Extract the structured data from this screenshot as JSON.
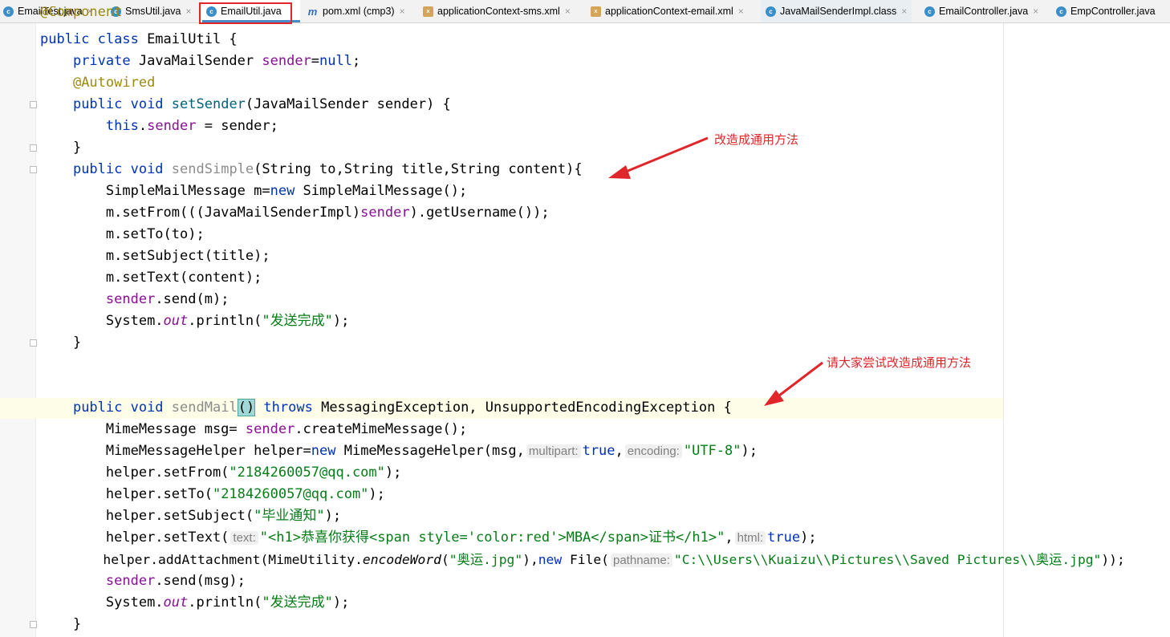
{
  "tabs": [
    {
      "label": "EmailTest.java",
      "icon": "java-class-icon"
    },
    {
      "label": "SmsUtil.java",
      "icon": "java-class-icon"
    },
    {
      "label": "EmailUtil.java",
      "icon": "java-class-icon"
    },
    {
      "label": "pom.xml (cmp3)",
      "icon": "maven-icon"
    },
    {
      "label": "applicationContext-sms.xml",
      "icon": "xml-file-icon"
    },
    {
      "label": "applicationContext-email.xml",
      "icon": "xml-file-icon"
    },
    {
      "label": "JavaMailSenderImpl.class",
      "icon": "class-file-icon"
    },
    {
      "label": "EmailController.java",
      "icon": "java-class-icon"
    },
    {
      "label": "EmpController.java",
      "icon": "java-class-icon"
    }
  ],
  "active_tab": "EmailUtil.java",
  "code": {
    "l0": "@Component",
    "l1_kw": "public class",
    "l1_rest": " EmailUtil {",
    "l2_kw": "private",
    "l2_type": " JavaMailSender ",
    "l2_field": "sender",
    "l2_eq": "=",
    "l2_null": "null",
    "l2_end": ";",
    "l3": "@Autowired",
    "l4_kw": "public void",
    "l4_name": "setSender",
    "l4_rest": "(JavaMailSender sender) {",
    "l5_this": "this",
    "l5_dot": ".",
    "l5_field": "sender",
    "l5_rest": " = sender;",
    "l6": "}",
    "l7_kw": "public void",
    "l7_name": "sendSimple",
    "l7_rest": "(String to,String title,String content){",
    "l8_a": "SimpleMailMessage m=",
    "l8_new": "new",
    "l8_b": " SimpleMailMessage();",
    "l9_a": "m.setFrom(((JavaMailSenderImpl)",
    "l9_field": "sender",
    "l9_b": ").getUsername());",
    "l10": "m.setTo(to);",
    "l11": "m.setSubject(title);",
    "l12": "m.setText(content);",
    "l13_field": "sender",
    "l13_rest": ".send(m);",
    "l14_a": "System.",
    "l14_out": "out",
    "l14_b": ".println(",
    "l14_str": "\"发送完成\"",
    "l14_c": ");",
    "l15": "}",
    "l16_kw": "public void",
    "l16_name": "sendMail",
    "l16_paren": "()",
    "l16_throws": "throws",
    "l16_rest": " MessagingException, UnsupportedEncodingException {",
    "l17_a": "MimeMessage msg= ",
    "l17_field": "sender",
    "l17_b": ".createMimeMessage();",
    "l18_a": "MimeMessageHelper helper=",
    "l18_new": "new",
    "l18_b": " MimeMessageHelper(msg,",
    "l18_hint1": "multipart:",
    "l18_true": "true",
    "l18_comma": ",",
    "l18_hint2": "encoding:",
    "l18_str": "\"UTF-8\"",
    "l18_end": ");",
    "l19_a": "helper.setFrom(",
    "l19_str": "\"2184260057@qq.com\"",
    "l19_end": ");",
    "l20_a": "helper.setTo(",
    "l20_str": "\"2184260057@qq.com\"",
    "l20_end": ");",
    "l21_a": "helper.setSubject(",
    "l21_str": "\"毕业通知\"",
    "l21_end": ");",
    "l22_a": "helper.setText(",
    "l22_hint1": "text:",
    "l22_str": "\"<h1>恭喜你获得<span style='color:red'>MBA</span>证书</h1>\"",
    "l22_comma": ",",
    "l22_hint2": "html:",
    "l22_true": "true",
    "l22_end": ");",
    "l23_a": "helper.addAttachment(MimeUtility.",
    "l23_enc": "encodeWord",
    "l23_b": "(",
    "l23_str1": "\"奥运.jpg\"",
    "l23_c": "),",
    "l23_new": "new",
    "l23_d": " File(",
    "l23_hint": "pathname:",
    "l23_str2": "\"C:\\\\Users\\\\Kuaizu\\\\Pictures\\\\Saved Pictures\\\\奥运.jpg\"",
    "l23_end": "));",
    "l24_field": "sender",
    "l24_rest": ".send(msg);",
    "l25_a": "System.",
    "l25_out": "out",
    "l25_b": ".println(",
    "l25_str": "\"发送完成\"",
    "l25_c": ");",
    "l26": "}"
  },
  "annotations": {
    "note1": "改造成通用方法",
    "note2": "请大家尝试改造成通用方法"
  },
  "colors": {
    "annotation_red": "#e0262a",
    "keyword": "#0033b3",
    "field": "#871094",
    "string": "#067d17",
    "annotation": "#9e880d"
  }
}
